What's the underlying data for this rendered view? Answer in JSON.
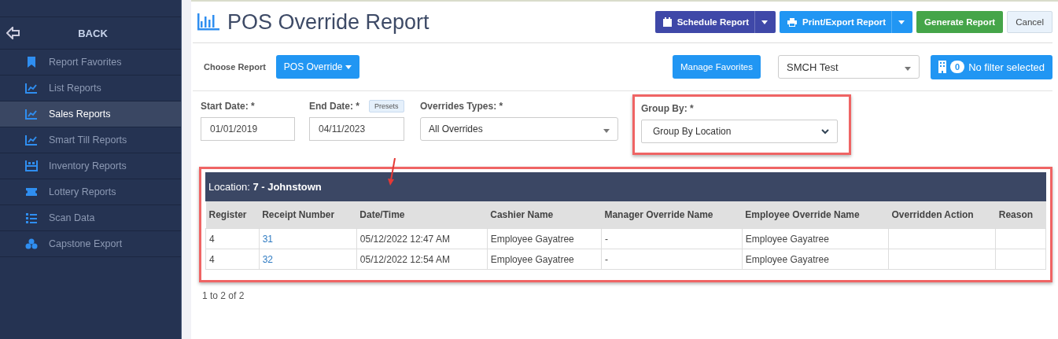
{
  "sidebar": {
    "back_label": "BACK",
    "items": [
      {
        "label": "Report Favorites",
        "kind": "bookmark",
        "selected": false
      },
      {
        "label": "List Reports",
        "kind": "chart",
        "selected": false
      },
      {
        "label": "Sales Reports",
        "kind": "chart",
        "selected": true
      },
      {
        "label": "Smart Till Reports",
        "kind": "chart",
        "selected": false
      },
      {
        "label": "Inventory Reports",
        "kind": "shelf",
        "selected": false
      },
      {
        "label": "Lottery Reports",
        "kind": "ticket",
        "selected": false
      },
      {
        "label": "Scan Data",
        "kind": "list",
        "selected": false
      },
      {
        "label": "Capstone Export",
        "kind": "boxes",
        "selected": false
      }
    ]
  },
  "header": {
    "title": "POS Override Report",
    "buttons": [
      {
        "label": "Schedule Report",
        "kind": "schedule"
      },
      {
        "label": "Print/Export Report",
        "kind": "print"
      },
      {
        "label": "Generate Report",
        "kind": "generate"
      },
      {
        "label": "Cancel",
        "kind": "cancel"
      }
    ]
  },
  "choose": {
    "label": "Choose Report",
    "report": "POS Override",
    "favorites": "Manage Favorites",
    "store": "SMCH Test",
    "filter_count": "0",
    "filter_label": "No filter selected"
  },
  "filters": {
    "start_label": "Start Date: *",
    "start": "01/01/2019",
    "end_label": "End Date: *",
    "presets": "Presets",
    "end": "04/11/2023",
    "types_label": "Overrides Types: *",
    "types": "All Overrides",
    "group_label": "Group By: *",
    "group": "Group By Location",
    "group_highlighted": true
  },
  "result": {
    "highlighted": true,
    "location_label": "Location:",
    "location": "7 - Johnstown",
    "columns": [
      "Register",
      "Receipt Number",
      "Date/Time",
      "Cashier Name",
      "Manager Override Name",
      "Employee Override Name",
      "Overridden Action",
      "Reason"
    ],
    "rows": [
      [
        "4",
        "31",
        "05/12/2022 12:47 AM",
        "Employee Gayatree",
        "-",
        "Employee Gayatree",
        "",
        ""
      ],
      [
        "4",
        "32",
        "05/12/2022 12:54 AM",
        "Employee Gayatree",
        "-",
        "Employee Gayatree",
        "",
        ""
      ]
    ],
    "footer": "1 to 2 of 2"
  }
}
